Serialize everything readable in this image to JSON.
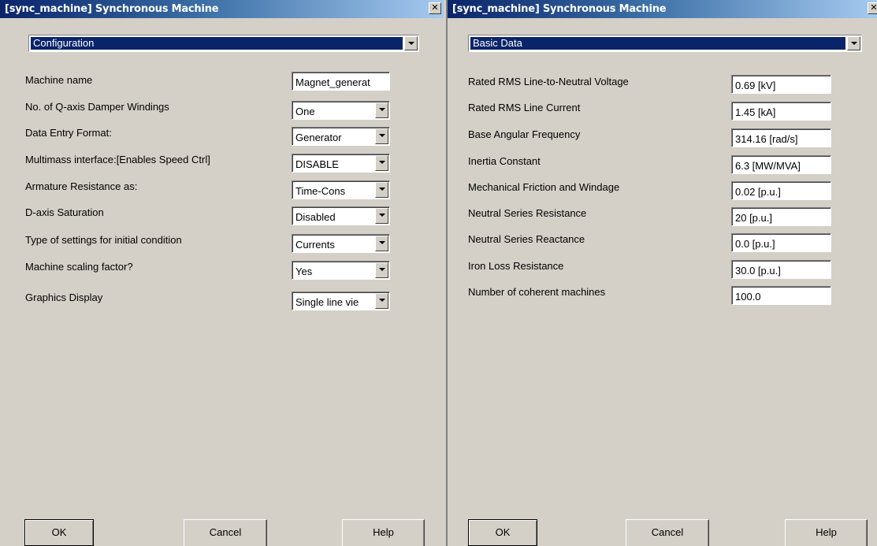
{
  "left": {
    "title": "[sync_machine] Synchronous Machine",
    "close_glyph": "✕",
    "category": "Configuration",
    "params": [
      {
        "label": "Machine name",
        "value": "Magnet_generat"
      },
      {
        "label": "No. of Q-axis Damper Windings",
        "value": "One"
      },
      {
        "label": "Data Entry Format:",
        "value": "Generator"
      },
      {
        "label": "Multimass interface:[Enables Speed Ctrl]",
        "value": "DISABLE"
      },
      {
        "label": "Armature Resistance as:",
        "value": "Time-Cons"
      },
      {
        "label": "D-axis Saturation",
        "value": "Disabled"
      },
      {
        "label": "Type of settings for initial condition",
        "value": "Currents"
      },
      {
        "label": "Machine scaling factor?",
        "value": "Yes"
      },
      {
        "label": "Graphics Display",
        "value": "Single line vie"
      }
    ],
    "buttons": {
      "ok": "OK",
      "cancel": "Cancel",
      "help": "Help"
    }
  },
  "right": {
    "title": "[sync_machine] Synchronous Machine",
    "close_glyph": "✕",
    "category": "Basic Data",
    "params": [
      {
        "label": "Rated RMS Line-to-Neutral Voltage",
        "value": "0.69 [kV]"
      },
      {
        "label": "Rated RMS Line Current",
        "value": "1.45 [kA]"
      },
      {
        "label": "Base Angular Frequency",
        "value": "314.16 [rad/s]"
      },
      {
        "label": "Inertia Constant",
        "value": "6.3 [MW/MVA]"
      },
      {
        "label": "Mechanical Friction and Windage",
        "value": "0.02 [p.u.]"
      },
      {
        "label": "Neutral Series Resistance",
        "value": "20 [p.u.]"
      },
      {
        "label": "Neutral Series Reactance",
        "value": "0.0 [p.u.]"
      },
      {
        "label": "Iron Loss Resistance",
        "value": "30.0 [p.u.]"
      },
      {
        "label": "Number of coherent machines",
        "value": "100.0"
      }
    ],
    "buttons": {
      "ok": "OK",
      "cancel": "Cancel",
      "help": "Help"
    }
  },
  "icons": {
    "dropdown": "chevron-down-icon",
    "close": "close-icon"
  },
  "colors": {
    "titlebar_start": "#0a246a",
    "titlebar_end": "#a6caf0",
    "dialog_bg": "#d4d0c8",
    "selection": "#0a246a"
  }
}
